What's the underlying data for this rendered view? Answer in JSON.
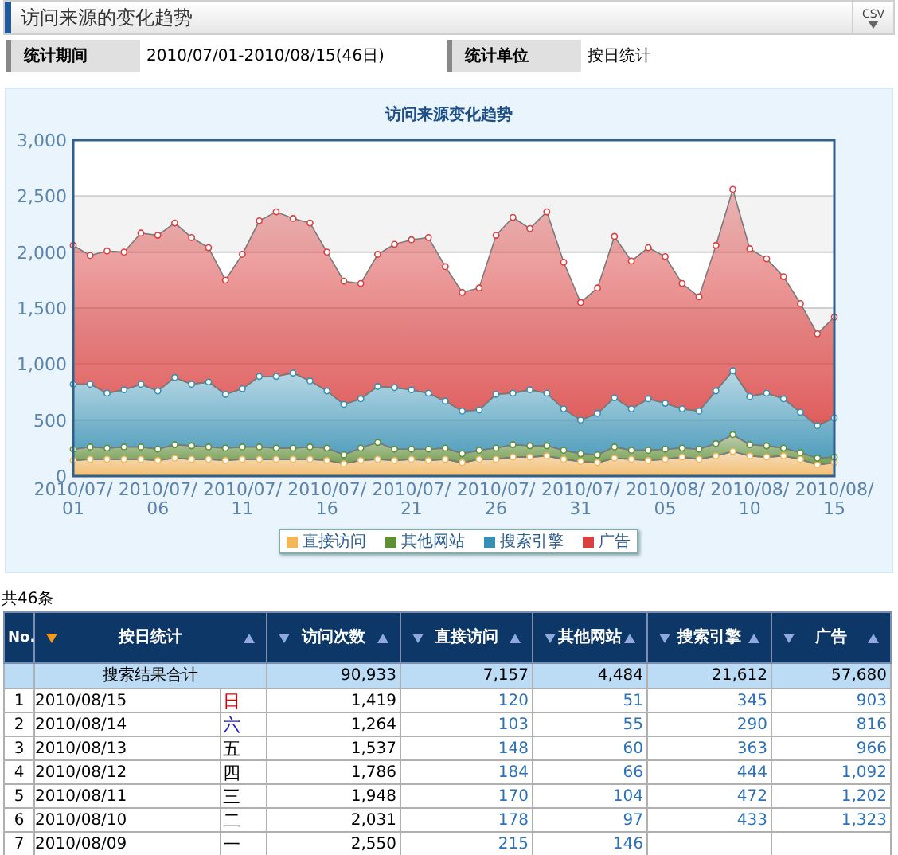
{
  "header": {
    "title": "访问来源的变化趋势",
    "export_label": "CSV"
  },
  "filters": [
    {
      "label": "统计期间",
      "value": "2010/07/01-2010/08/15(46日)"
    },
    {
      "label": "统计单位",
      "value": "按日统计"
    }
  ],
  "chart": {
    "chart_data": {
      "type": "area",
      "title": "访问来源变化趋势",
      "stacked": true,
      "grid": true,
      "categories": [
        "2010/07/01",
        null,
        null,
        null,
        null,
        "2010/07/06",
        null,
        null,
        null,
        null,
        "2010/07/11",
        null,
        null,
        null,
        null,
        "2010/07/16",
        null,
        null,
        null,
        null,
        "2010/07/21",
        null,
        null,
        null,
        null,
        "2010/07/26",
        null,
        null,
        null,
        null,
        "2010/07/31",
        null,
        null,
        null,
        null,
        "2010/08/05",
        null,
        null,
        null,
        null,
        "2010/08/10",
        null,
        null,
        null,
        null,
        "2010/08/15"
      ],
      "series": [
        {
          "name": "直接访问",
          "color": "#f5b65a",
          "values": [
            140,
            150,
            150,
            150,
            150,
            140,
            160,
            150,
            150,
            140,
            150,
            150,
            150,
            150,
            150,
            140,
            110,
            140,
            150,
            140,
            150,
            140,
            150,
            120,
            150,
            150,
            170,
            170,
            180,
            150,
            130,
            120,
            160,
            150,
            140,
            150,
            170,
            150,
            180,
            220,
            180,
            170,
            180,
            150,
            100,
            120
          ]
        },
        {
          "name": "其他网站",
          "color": "#5f8f35",
          "values": [
            100,
            110,
            100,
            110,
            110,
            100,
            120,
            120,
            110,
            110,
            110,
            110,
            100,
            100,
            110,
            110,
            80,
            110,
            150,
            100,
            90,
            100,
            100,
            80,
            80,
            100,
            110,
            100,
            90,
            80,
            70,
            70,
            100,
            80,
            90,
            90,
            80,
            90,
            110,
            150,
            100,
            100,
            70,
            60,
            60,
            50
          ]
        },
        {
          "name": "搜索引擎",
          "color": "#3590b4",
          "values": [
            580,
            560,
            490,
            510,
            560,
            520,
            600,
            550,
            580,
            480,
            520,
            630,
            640,
            670,
            590,
            510,
            450,
            440,
            500,
            550,
            530,
            500,
            420,
            380,
            360,
            480,
            460,
            500,
            470,
            370,
            300,
            370,
            440,
            370,
            460,
            410,
            350,
            340,
            470,
            570,
            430,
            470,
            440,
            360,
            290,
            350
          ]
        },
        {
          "name": "广告",
          "color": "#d9403f",
          "values": [
            1240,
            1150,
            1270,
            1230,
            1350,
            1390,
            1380,
            1310,
            1200,
            1020,
            1200,
            1390,
            1470,
            1380,
            1410,
            1240,
            1100,
            1030,
            1180,
            1280,
            1340,
            1390,
            1200,
            1060,
            1090,
            1420,
            1570,
            1440,
            1620,
            1310,
            1050,
            1120,
            1440,
            1320,
            1350,
            1310,
            1120,
            1020,
            1300,
            1620,
            1320,
            1200,
            1090,
            970,
            820,
            900
          ]
        }
      ],
      "ylim": [
        0,
        3000
      ],
      "yticks": [
        {
          "value": 0,
          "label": "0"
        },
        {
          "value": 500,
          "label": "500"
        },
        {
          "value": 1000,
          "label": "1,000"
        },
        {
          "value": 1500,
          "label": "1,500"
        },
        {
          "value": 2000,
          "label": "2,000"
        },
        {
          "value": 2500,
          "label": "2,500"
        },
        {
          "value": 3000,
          "label": "3,000"
        }
      ]
    }
  },
  "record_count": "共46条",
  "table": {
    "columns": [
      {
        "label": "No.",
        "kind": "index"
      },
      {
        "label": "按日统计",
        "kind": "sortable",
        "sorted": true
      },
      {
        "label": "访问次数",
        "kind": "sortable",
        "sorted": false
      },
      {
        "label": "直接访问",
        "kind": "sortable",
        "sorted": false
      },
      {
        "label": "其他网站",
        "kind": "sortable",
        "sorted": false
      },
      {
        "label": "搜索引擎",
        "kind": "sortable",
        "sorted": false
      },
      {
        "label": "广告",
        "kind": "sortable",
        "sorted": false
      }
    ],
    "total": {
      "label": "搜索结果合计",
      "visits": "90,933",
      "direct": "7,157",
      "other": "4,484",
      "search": "21,612",
      "ad": "57,680"
    },
    "rows": [
      {
        "no": "1",
        "date": "2010/08/15",
        "weekday": "日",
        "color": "#e00000",
        "visits": "1,419",
        "direct": "120",
        "other": "51",
        "search": "345",
        "ad": "903"
      },
      {
        "no": "2",
        "date": "2010/08/14",
        "weekday": "六",
        "color": "#2020c0",
        "visits": "1,264",
        "direct": "103",
        "other": "55",
        "search": "290",
        "ad": "816"
      },
      {
        "no": "3",
        "date": "2010/08/13",
        "weekday": "五",
        "color": "#000000",
        "visits": "1,537",
        "direct": "148",
        "other": "60",
        "search": "363",
        "ad": "966"
      },
      {
        "no": "4",
        "date": "2010/08/12",
        "weekday": "四",
        "color": "#000000",
        "visits": "1,786",
        "direct": "184",
        "other": "66",
        "search": "444",
        "ad": "1,092"
      },
      {
        "no": "5",
        "date": "2010/08/11",
        "weekday": "三",
        "color": "#000000",
        "visits": "1,948",
        "direct": "170",
        "other": "104",
        "search": "472",
        "ad": "1,202"
      },
      {
        "no": "6",
        "date": "2010/08/10",
        "weekday": "二",
        "color": "#000000",
        "visits": "2,031",
        "direct": "178",
        "other": "97",
        "search": "433",
        "ad": "1,323"
      },
      {
        "no": "7",
        "date": "2010/08/09",
        "weekday": "一",
        "color": "#000000",
        "visits": "2,550",
        "direct": "215",
        "other": "146"
      }
    ]
  }
}
